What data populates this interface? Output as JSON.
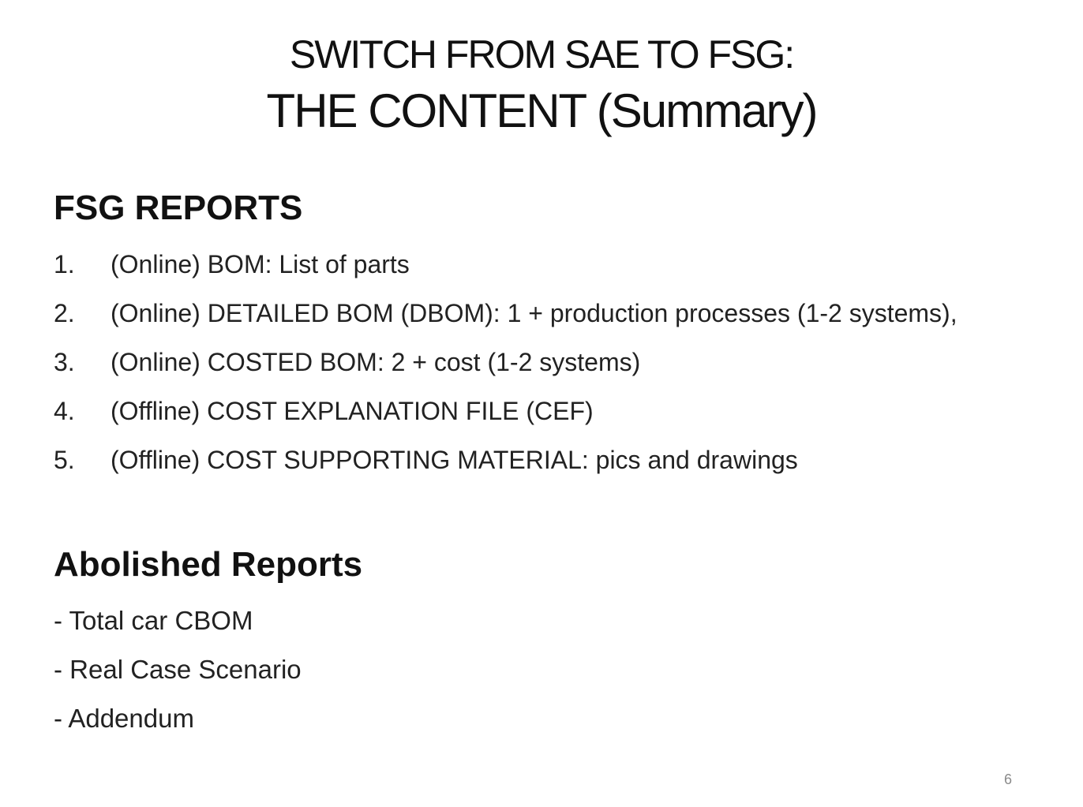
{
  "slide": {
    "title_line_1": "SWITCH FROM SAE TO FSG:",
    "title_line_2": "THE CONTENT (Summary)",
    "fsg_reports": {
      "heading": "FSG REPORTS",
      "items": [
        {
          "number": "1.",
          "text": "(Online) BOM: List of parts"
        },
        {
          "number": "2.",
          "text": "(Online) DETAILED BOM (DBOM): 1 + production processes (1-2 systems),"
        },
        {
          "number": "3.",
          "text": "(Online) COSTED BOM: 2 + cost (1-2 systems)"
        },
        {
          "number": "4.",
          "text": "(Offline) COST EXPLANATION FILE (CEF)"
        },
        {
          "number": "5.",
          "text": "(Offline) COST SUPPORTING MATERIAL: pics and drawings"
        }
      ]
    },
    "abolished_reports": {
      "heading": "Abolished Reports",
      "items": [
        "- Total car CBOM",
        "- Real Case Scenario",
        "- Addendum"
      ]
    },
    "page_number": "6"
  }
}
